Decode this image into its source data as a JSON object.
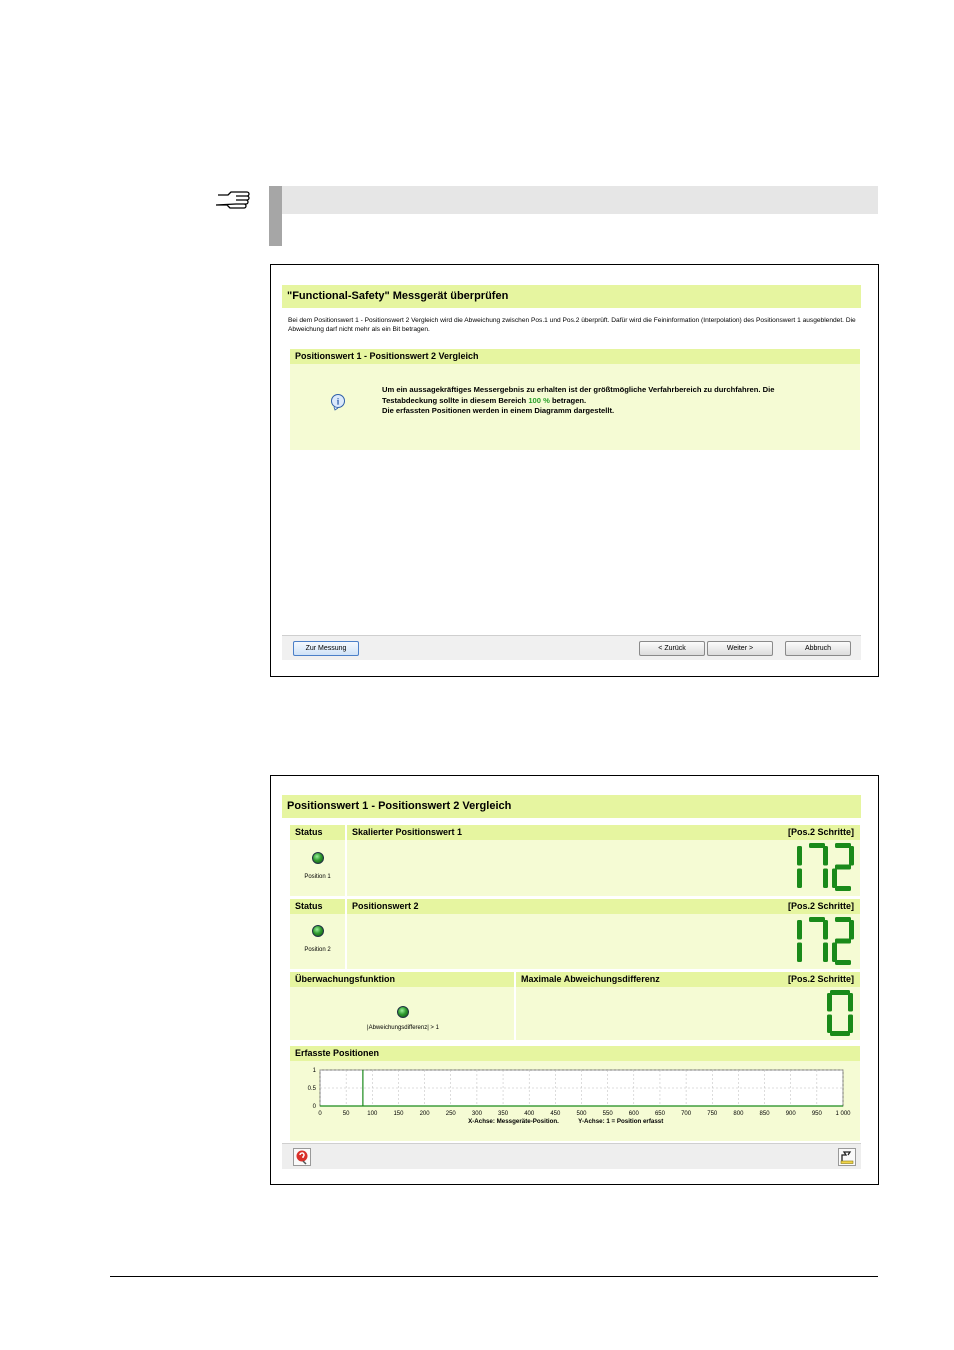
{
  "dialog1": {
    "title": "\"Functional-Safety\" Messgerät überprüfen",
    "description": "Bei dem Positionswert 1 - Positionswert 2 Vergleich wird die Abweichung zwischen Pos.1 und Pos.2 überprüft. Dafür wird die Feininformation (Interpolation) des Positionswert 1 ausgeblendet. Die Abweichung darf nicht mehr als ein Bit betragen.",
    "section_title": "Positionswert 1 - Positionswert 2 Vergleich",
    "info_line1": "Um ein aussagekräftiges Messergebnis zu erhalten ist der größtmögliche Verfahrbereich zu durchfahren. Die",
    "info_line2_a": "Testabdeckung sollte in diesem Bereich",
    "info_line2_pct": "100 %",
    "info_line2_b": "betragen.",
    "info_line3": "Die erfassten Positionen werden in einem Diagramm dargestellt.",
    "buttons": {
      "measure": "Zur Messung",
      "back": "< Zurück",
      "next": "Weiter >",
      "cancel": "Abbruch"
    }
  },
  "dialog2": {
    "title": "Positionswert 1 - Positionswert 2 Vergleich",
    "row1": {
      "status_header": "Status",
      "value_header": "Skalierter Positionswert 1",
      "unit": "[Pos.2 Schritte]",
      "led_label": "Position 1",
      "value": "172"
    },
    "row2": {
      "status_header": "Status",
      "value_header": "Positionswert 2",
      "unit": "[Pos.2 Schritte]",
      "led_label": "Position 2",
      "value": "172"
    },
    "row3": {
      "monitor_header": "Überwachungsfunktion",
      "value_header": "Maximale Abweichungsdifferenz",
      "unit": "[Pos.2 Schritte]",
      "led_label": "|Abweichungsdifferenz| > 1",
      "value": "0"
    },
    "chart_header": "Erfasste Positionen",
    "x_caption": "X-Achse: Messgeräte-Position.",
    "y_caption": "Y-Achse: 1 = Position erfasst"
  },
  "colors": {
    "header_green": "#e6f5a0",
    "panel_green": "#f5fbd4",
    "digit_green": "#1a8a1a"
  },
  "chart_data": {
    "type": "line",
    "x_ticks": [
      "0",
      "50",
      "100",
      "150",
      "200",
      "250",
      "300",
      "350",
      "400",
      "450",
      "500",
      "550",
      "600",
      "650",
      "700",
      "750",
      "800",
      "850",
      "900",
      "950",
      "1 000"
    ],
    "y_ticks": [
      "1",
      "0.5",
      "0"
    ],
    "xlim": [
      0,
      1000
    ],
    "ylim": [
      0,
      1
    ],
    "grid": true,
    "series": [
      {
        "points": [
          [
            0,
            0
          ],
          [
            82,
            0
          ],
          [
            82,
            1
          ],
          [
            82,
            0
          ],
          [
            1000,
            0
          ]
        ]
      }
    ]
  }
}
